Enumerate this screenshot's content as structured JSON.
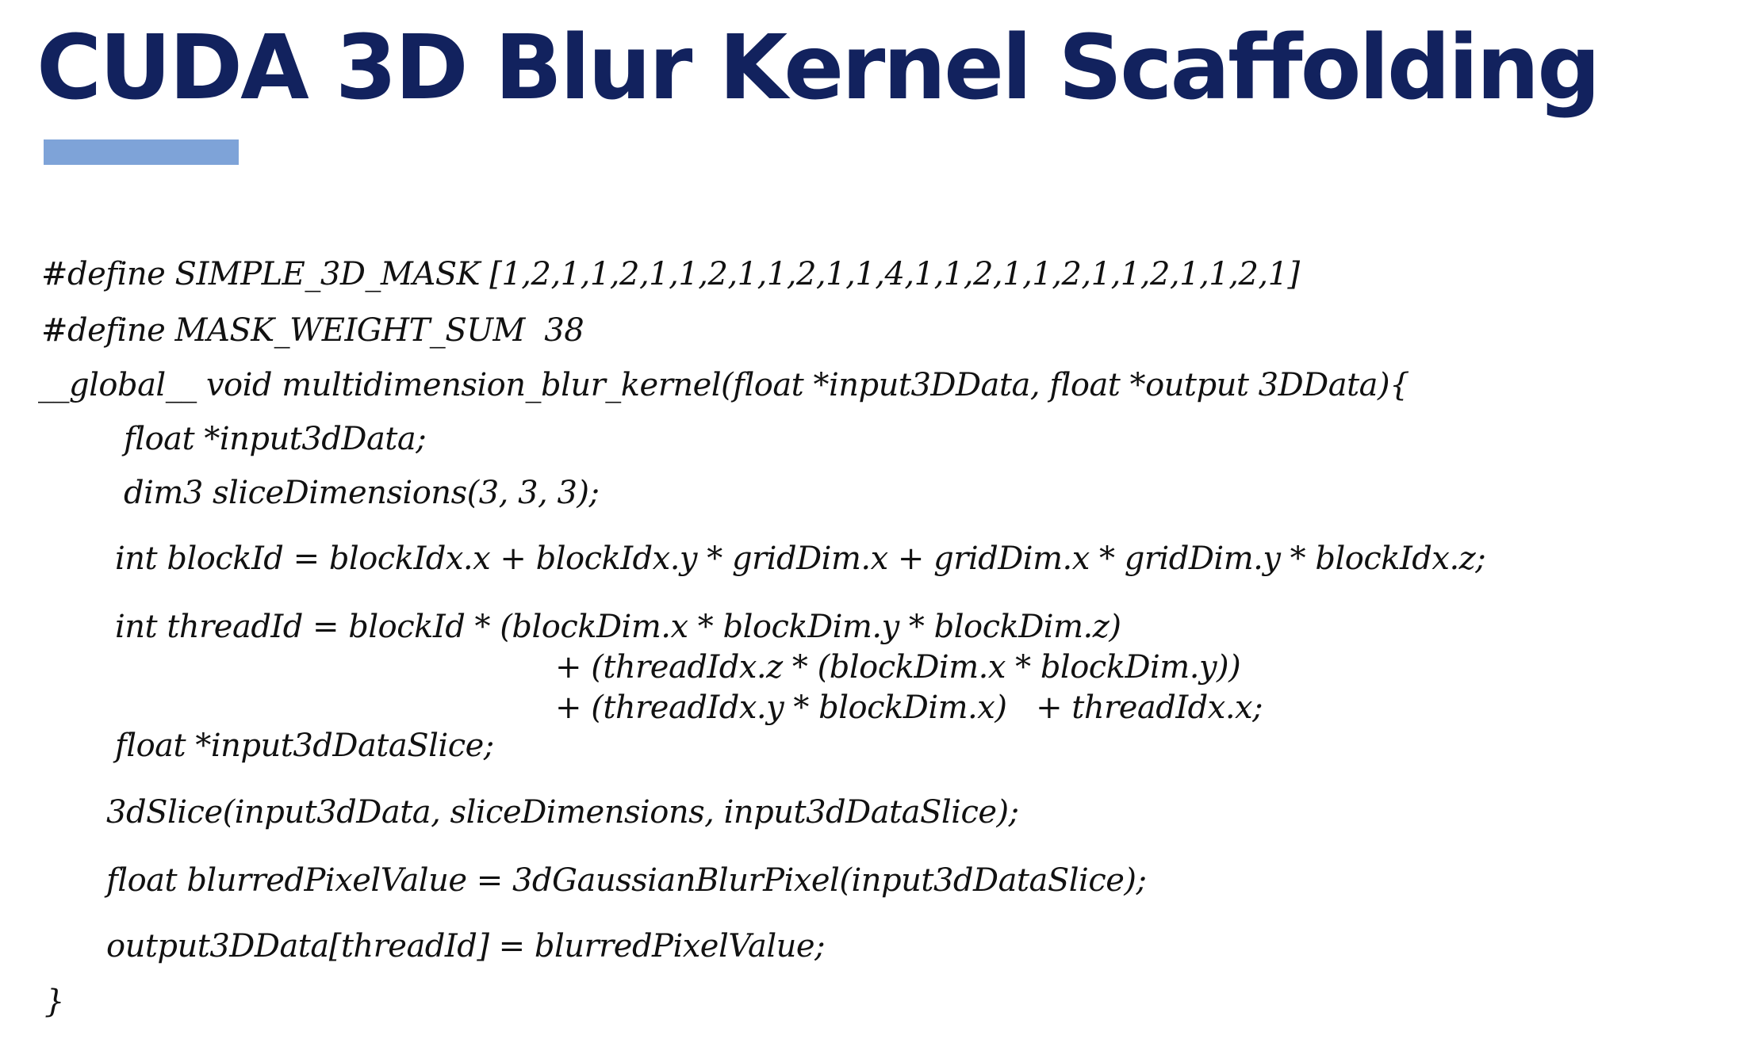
{
  "slide": {
    "title": "CUDA 3D Blur Kernel Scaffolding",
    "accent_color": "#7ea3d8",
    "title_color": "#12225e",
    "code_lines": [
      "#define SIMPLE_3D_MASK [1,2,1,1,2,1,1,2,1,1,2,1,1,4,1,1,2,1,1,2,1,1,2,1,1,2,1]",
      "#define MASK_WEIGHT_SUM  38",
      "__global__ void multidimension_blur_kernel(float *input3DData, float *output 3DData){",
      "float *input3dData;",
      "dim3 sliceDimensions(3, 3, 3);",
      "int blockId = blockIdx.x + blockIdx.y * gridDim.x + gridDim.x * gridDim.y * blockIdx.z;",
      "int threadId = blockId * (blockDim.x * blockDim.y * blockDim.z)",
      "+ (threadIdx.z * (blockDim.x * blockDim.y))",
      "+ (threadIdx.y * blockDim.x)   + threadIdx.x;",
      "float *input3dDataSlice;",
      "3dSlice(input3dData, sliceDimensions, input3dDataSlice);",
      "float blurredPixelValue = 3dGaussianBlurPixel(input3dDataSlice);",
      "output3DData[threadId] = blurredPixelValue;",
      "}"
    ]
  }
}
